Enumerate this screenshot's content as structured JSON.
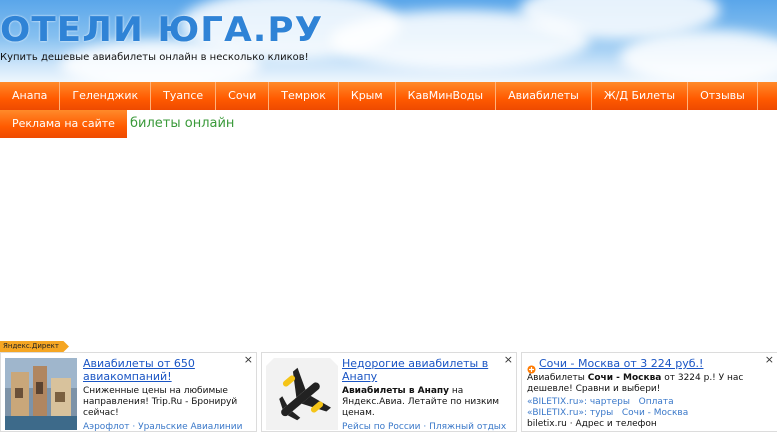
{
  "header": {
    "logo_text": "ОТЕЛИ ЮГА.РУ",
    "tagline": "Купить дешевые авиабилеты онлайн в несколько кликов!"
  },
  "nav": {
    "items": [
      {
        "label": "Анапа"
      },
      {
        "label": "Геленджик"
      },
      {
        "label": "Туапсе"
      },
      {
        "label": "Сочи"
      },
      {
        "label": "Темрюк"
      },
      {
        "label": "Крым"
      },
      {
        "label": "КавМинВоды"
      },
      {
        "label": "Авиабилеты"
      },
      {
        "label": "Ж/Д Билеты"
      },
      {
        "label": "Отзывы"
      }
    ],
    "second_row": "Реклама на сайте"
  },
  "main": {
    "subtitle": "билеты онлайн"
  },
  "yandex_direct": {
    "label": "Яндекс.Директ",
    "close_glyph": "×",
    "ads": [
      {
        "title": "Авиабилеты от 650 авиакомпаний!",
        "text": "Сниженные цены на любимые направления! Trip.Ru - Бронируй сейчас!",
        "links": "Аэрофлот · Уральские Авиалинии"
      },
      {
        "title": "Недорогие авиабилеты в Анапу",
        "text_bold": "Авиабилеты в Анапу",
        "text": " на Яндекс.Авиа. Летайте по низким ценам.",
        "links": "Рейсы по России · Пляжный отдых"
      },
      {
        "title": "Сочи - Москва от 3 224 руб.!",
        "text_prefix": "Авиабилеты ",
        "text_bold": "Сочи - Москва",
        "text": " от 3224 р.! У нас дешевле! Сравни и выбери!",
        "link1a": "«BILETIX.ru»: чартеры",
        "link1b": "Оплата",
        "link2a": "«BILETIX.ru»: туры",
        "link2b": "Сочи - Москва",
        "footer": "biletix.ru · Адрес и телефон"
      }
    ]
  },
  "colors": {
    "nav_orange": "#ff5a00",
    "link_blue": "#1a55c4",
    "green_text": "#3a9a3a",
    "logo_blue": "#2f83d6"
  }
}
